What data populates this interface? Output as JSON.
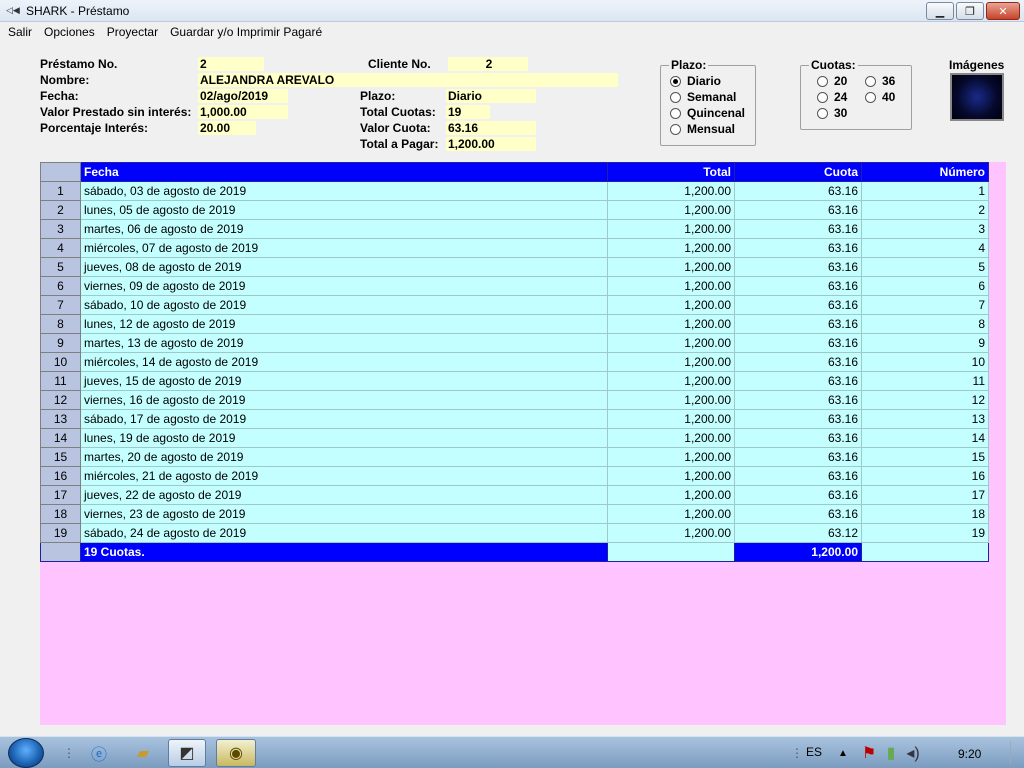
{
  "window": {
    "title": "SHARK - Préstamo",
    "min_label": "▁",
    "max_label": "❐",
    "close_label": "✕"
  },
  "menu": [
    "Salir",
    "Opciones",
    "Proyectar",
    "Guardar y/o Imprimir Pagaré"
  ],
  "form": {
    "prestamo_no_label": "Préstamo No.",
    "prestamo_no": "2",
    "cliente_no_label": "Cliente No.",
    "cliente_no": "2",
    "nombre_label": "Nombre:",
    "nombre": "ALEJANDRA AREVALO",
    "fecha_label": "Fecha:",
    "fecha": "02/ago/2019",
    "plazo_label": "Plazo:",
    "plazo": "Diario",
    "valor_label": "Valor Prestado sin interés:",
    "valor": "1,000.00",
    "total_cuotas_label": "Total Cuotas:",
    "total_cuotas": "19",
    "porcentaje_label": "Porcentaje Interés:",
    "porcentaje": "20.00",
    "valor_cuota_label": "Valor Cuota:",
    "valor_cuota": "63.16",
    "total_pagar_label": "Total a Pagar:",
    "total_pagar": "1,200.00"
  },
  "plazo_group": {
    "title": "Plazo:",
    "options": [
      "Diario",
      "Semanal",
      "Quincenal",
      "Mensual"
    ],
    "selected": "Diario"
  },
  "cuotas_group": {
    "title": "Cuotas:",
    "options": [
      "20",
      "24",
      "30",
      "36",
      "40"
    ]
  },
  "images": {
    "title": "Imágenes"
  },
  "grid": {
    "headers": {
      "fecha": "Fecha",
      "total": "Total",
      "cuota": "Cuota",
      "numero": "Número"
    },
    "rows": [
      {
        "n": "1",
        "fecha": "sábado, 03 de agosto de 2019",
        "total": "1,200.00",
        "cuota": "63.16",
        "numero": "1"
      },
      {
        "n": "2",
        "fecha": "lunes, 05 de agosto de 2019",
        "total": "1,200.00",
        "cuota": "63.16",
        "numero": "2"
      },
      {
        "n": "3",
        "fecha": "martes, 06 de agosto de 2019",
        "total": "1,200.00",
        "cuota": "63.16",
        "numero": "3"
      },
      {
        "n": "4",
        "fecha": "miércoles, 07 de agosto de 2019",
        "total": "1,200.00",
        "cuota": "63.16",
        "numero": "4"
      },
      {
        "n": "5",
        "fecha": "jueves, 08 de agosto de 2019",
        "total": "1,200.00",
        "cuota": "63.16",
        "numero": "5"
      },
      {
        "n": "6",
        "fecha": "viernes, 09 de agosto de 2019",
        "total": "1,200.00",
        "cuota": "63.16",
        "numero": "6"
      },
      {
        "n": "7",
        "fecha": "sábado, 10 de agosto de 2019",
        "total": "1,200.00",
        "cuota": "63.16",
        "numero": "7"
      },
      {
        "n": "8",
        "fecha": "lunes, 12 de agosto de 2019",
        "total": "1,200.00",
        "cuota": "63.16",
        "numero": "8"
      },
      {
        "n": "9",
        "fecha": "martes, 13 de agosto de 2019",
        "total": "1,200.00",
        "cuota": "63.16",
        "numero": "9"
      },
      {
        "n": "10",
        "fecha": "miércoles, 14 de agosto de 2019",
        "total": "1,200.00",
        "cuota": "63.16",
        "numero": "10"
      },
      {
        "n": "11",
        "fecha": "jueves, 15 de agosto de 2019",
        "total": "1,200.00",
        "cuota": "63.16",
        "numero": "11"
      },
      {
        "n": "12",
        "fecha": "viernes, 16 de agosto de 2019",
        "total": "1,200.00",
        "cuota": "63.16",
        "numero": "12"
      },
      {
        "n": "13",
        "fecha": "sábado, 17 de agosto de 2019",
        "total": "1,200.00",
        "cuota": "63.16",
        "numero": "13"
      },
      {
        "n": "14",
        "fecha": "lunes, 19 de agosto de 2019",
        "total": "1,200.00",
        "cuota": "63.16",
        "numero": "14"
      },
      {
        "n": "15",
        "fecha": "martes, 20 de agosto de 2019",
        "total": "1,200.00",
        "cuota": "63.16",
        "numero": "15"
      },
      {
        "n": "16",
        "fecha": "miércoles, 21 de agosto de 2019",
        "total": "1,200.00",
        "cuota": "63.16",
        "numero": "16"
      },
      {
        "n": "17",
        "fecha": "jueves, 22 de agosto de 2019",
        "total": "1,200.00",
        "cuota": "63.16",
        "numero": "17"
      },
      {
        "n": "18",
        "fecha": "viernes, 23 de agosto de 2019",
        "total": "1,200.00",
        "cuota": "63.16",
        "numero": "18"
      },
      {
        "n": "19",
        "fecha": "sábado, 24 de agosto de 2019",
        "total": "1,200.00",
        "cuota": "63.12",
        "numero": "19"
      }
    ],
    "footer": {
      "label": "19 Cuotas.",
      "total": "1,200.00"
    }
  },
  "taskbar": {
    "language": "ES",
    "clock": "9:20"
  },
  "colors": {
    "header_blue": "#0000ff",
    "row_cyan": "#c4ffff",
    "bg_pink": "#ffc4ff",
    "field_yellow": "#ffffc8"
  }
}
